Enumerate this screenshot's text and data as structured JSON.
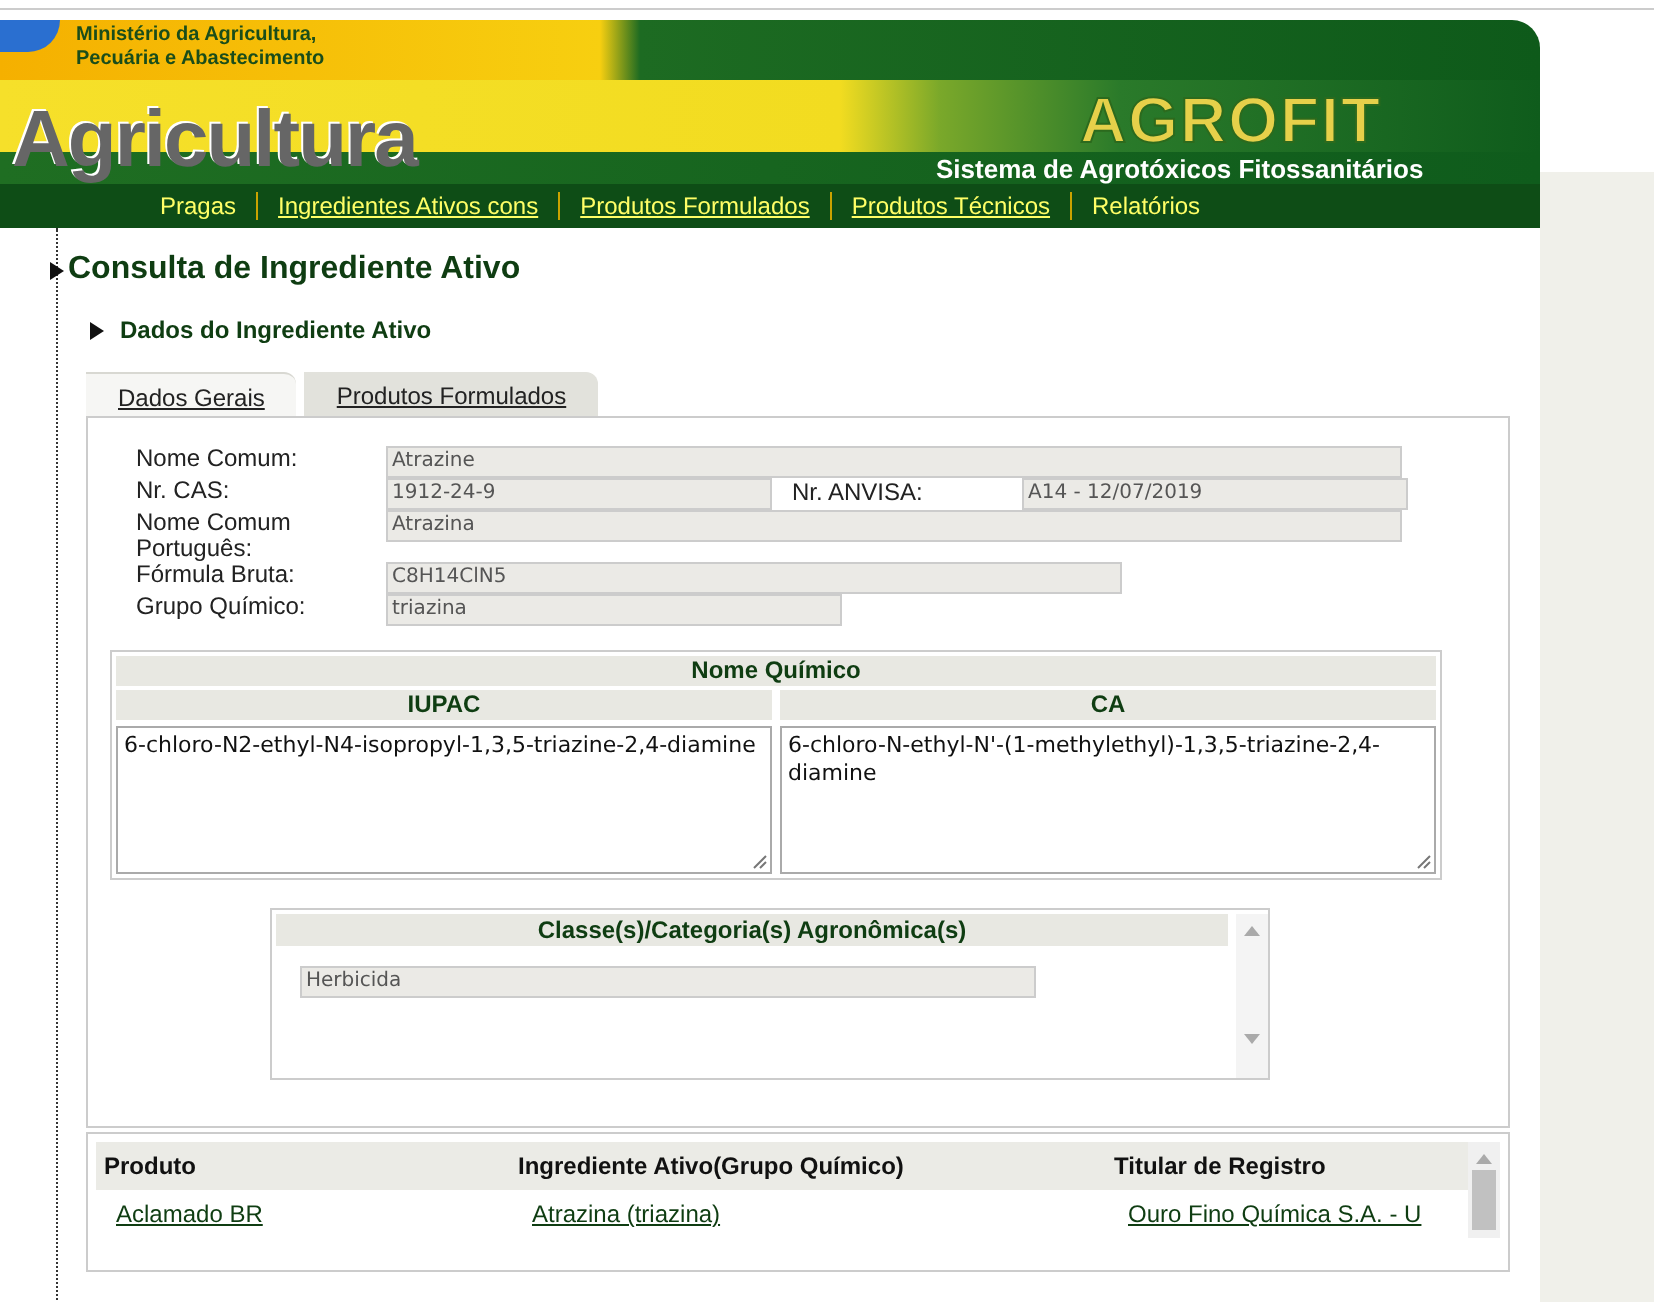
{
  "header": {
    "ministry": [
      "Ministério da Agricultura,",
      "Pecuária e Abastecimento"
    ],
    "brand": "Agricultura",
    "logo": "AGROFIT",
    "subtitle": "Sistema de Agrotóxicos Fitossanitários"
  },
  "nav": [
    {
      "label": "Pragas",
      "underlined": false
    },
    {
      "label": "Ingredientes Ativos cons",
      "underlined": true
    },
    {
      "label": "Produtos Formulados",
      "underlined": true
    },
    {
      "label": "Produtos Técnicos",
      "underlined": true
    },
    {
      "label": "Relatórios",
      "underlined": false
    }
  ],
  "page_title": "Consulta de Ingrediente Ativo",
  "section_title": "Dados do Ingrediente Ativo",
  "tabs": [
    {
      "label": "Dados Gerais",
      "selected": true
    },
    {
      "label": "Produtos Formulados",
      "selected": false
    }
  ],
  "fields": [
    [
      {
        "label": "Nome Comum:",
        "value": "Atrazine"
      }
    ],
    [
      {
        "label": "Nr. CAS:",
        "value": "1912-24-9"
      },
      {
        "label": "Nr. ANVISA:",
        "value": "A14 - 12/07/2019"
      }
    ],
    [
      {
        "label": "Nome Comum Português:",
        "value": "Atrazina"
      }
    ],
    [
      {
        "label": "Fórmula Bruta:",
        "value": "C8H14ClN5"
      }
    ],
    [
      {
        "label": "Grupo Químico:",
        "value": "triazina"
      }
    ]
  ],
  "chemical_name": {
    "title": "Nome Químico",
    "columns": [
      {
        "heading": "IUPAC",
        "value": "6-chloro-N2-ethyl-N4-isopropyl-1,3,5-triazine-2,4-diamine"
      },
      {
        "heading": "CA",
        "value": "6-chloro-N-ethyl-N'-(1-methylethyl)-1,3,5-triazine-2,4-diamine"
      }
    ]
  },
  "classes": {
    "title": "Classe(s)/Categoria(s) Agronômica(s)",
    "items": [
      "Herbicida"
    ]
  },
  "products": {
    "columns": [
      "Produto",
      "Ingrediente Ativo(Grupo Químico)",
      "Titular de Registro"
    ],
    "rows": [
      [
        "Aclamado BR",
        "Atrazina (triazina)",
        "Ouro Fino Química S.A. - U"
      ]
    ]
  }
}
